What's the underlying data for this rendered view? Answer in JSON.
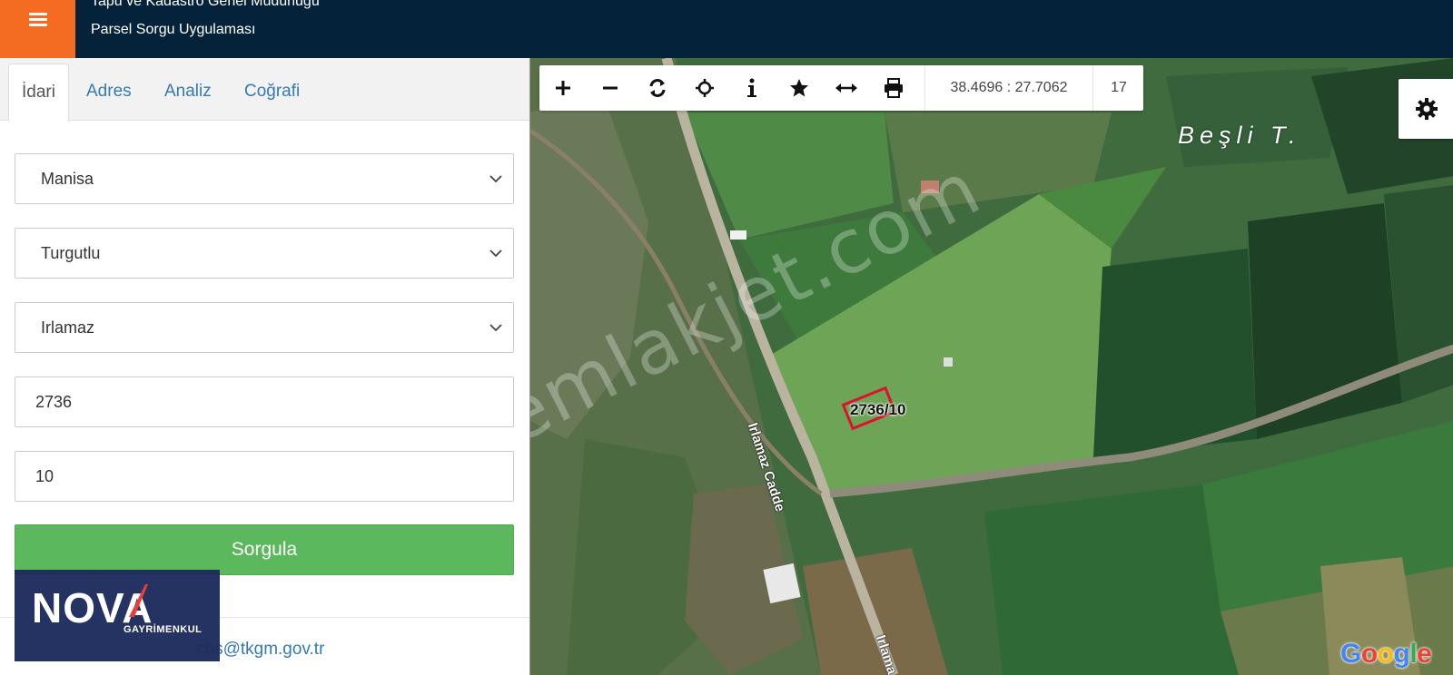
{
  "header": {
    "title_line1": "Tapu ve Kadastro Genel Müdürlüğü",
    "title_line2": "Parsel Sorgu Uygulaması"
  },
  "tabs": [
    {
      "label": "İdari",
      "active": true
    },
    {
      "label": "Adres",
      "active": false
    },
    {
      "label": "Analiz",
      "active": false
    },
    {
      "label": "Coğrafi",
      "active": false
    }
  ],
  "form": {
    "province": "Manisa",
    "district": "Turgutlu",
    "neighborhood": "Irlamaz",
    "block": "2736",
    "parcel": "10",
    "submit_label": "Sorgula"
  },
  "footer": {
    "email": "cbs@tkgm.gov.tr"
  },
  "logo": {
    "brand": "NOVA",
    "subtitle": "GAYRİMENKUL"
  },
  "map": {
    "coordinates": "38.4696 : 27.7062",
    "zoom_level": "17",
    "parcel_label": "2736/10",
    "place_label": "Beşli T.",
    "road_label_1": "Irlamaz Cadde",
    "road_label_2": "Irlama",
    "watermark": "emlakjet.com",
    "attribution": "Google"
  },
  "colors": {
    "header_bg": "#04223a",
    "menu_accent": "#f36c21",
    "submit_green": "#5cb85c",
    "link_blue": "#337ab7",
    "parcel_outline": "#e0102f"
  },
  "icons": {
    "toolbar": [
      "zoom-in-icon",
      "zoom-out-icon",
      "refresh-icon",
      "locate-icon",
      "info-icon",
      "favorite-star-icon",
      "measure-icon",
      "print-icon"
    ],
    "settings": "gear-icon",
    "menu": "hamburger-icon"
  }
}
